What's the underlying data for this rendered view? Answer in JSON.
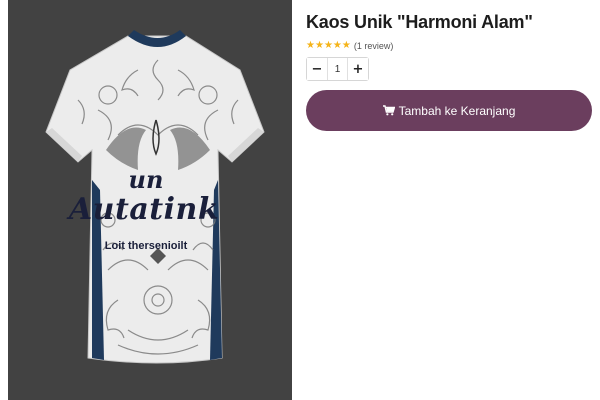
{
  "product": {
    "title": "Kaos Unik \"Harmoni Alam\"",
    "rating": {
      "stars": 5,
      "max_stars": 5,
      "review_text": "(1 review)"
    },
    "quantity": {
      "decrement_label": "−",
      "value": "1",
      "increment_label": "+"
    },
    "add_to_cart_label": "Tambah ke Keranjang"
  },
  "image": {
    "print_small": "un",
    "print_big": "Autatink",
    "print_sub": "Loit thersenioilt"
  },
  "colors": {
    "button": "#6b3e5e",
    "star": "#f5b41a",
    "gallery_bg": "#424242",
    "collar": "#1f3a5c"
  },
  "icons": {
    "cart": "cart-icon",
    "star": "star-icon"
  }
}
